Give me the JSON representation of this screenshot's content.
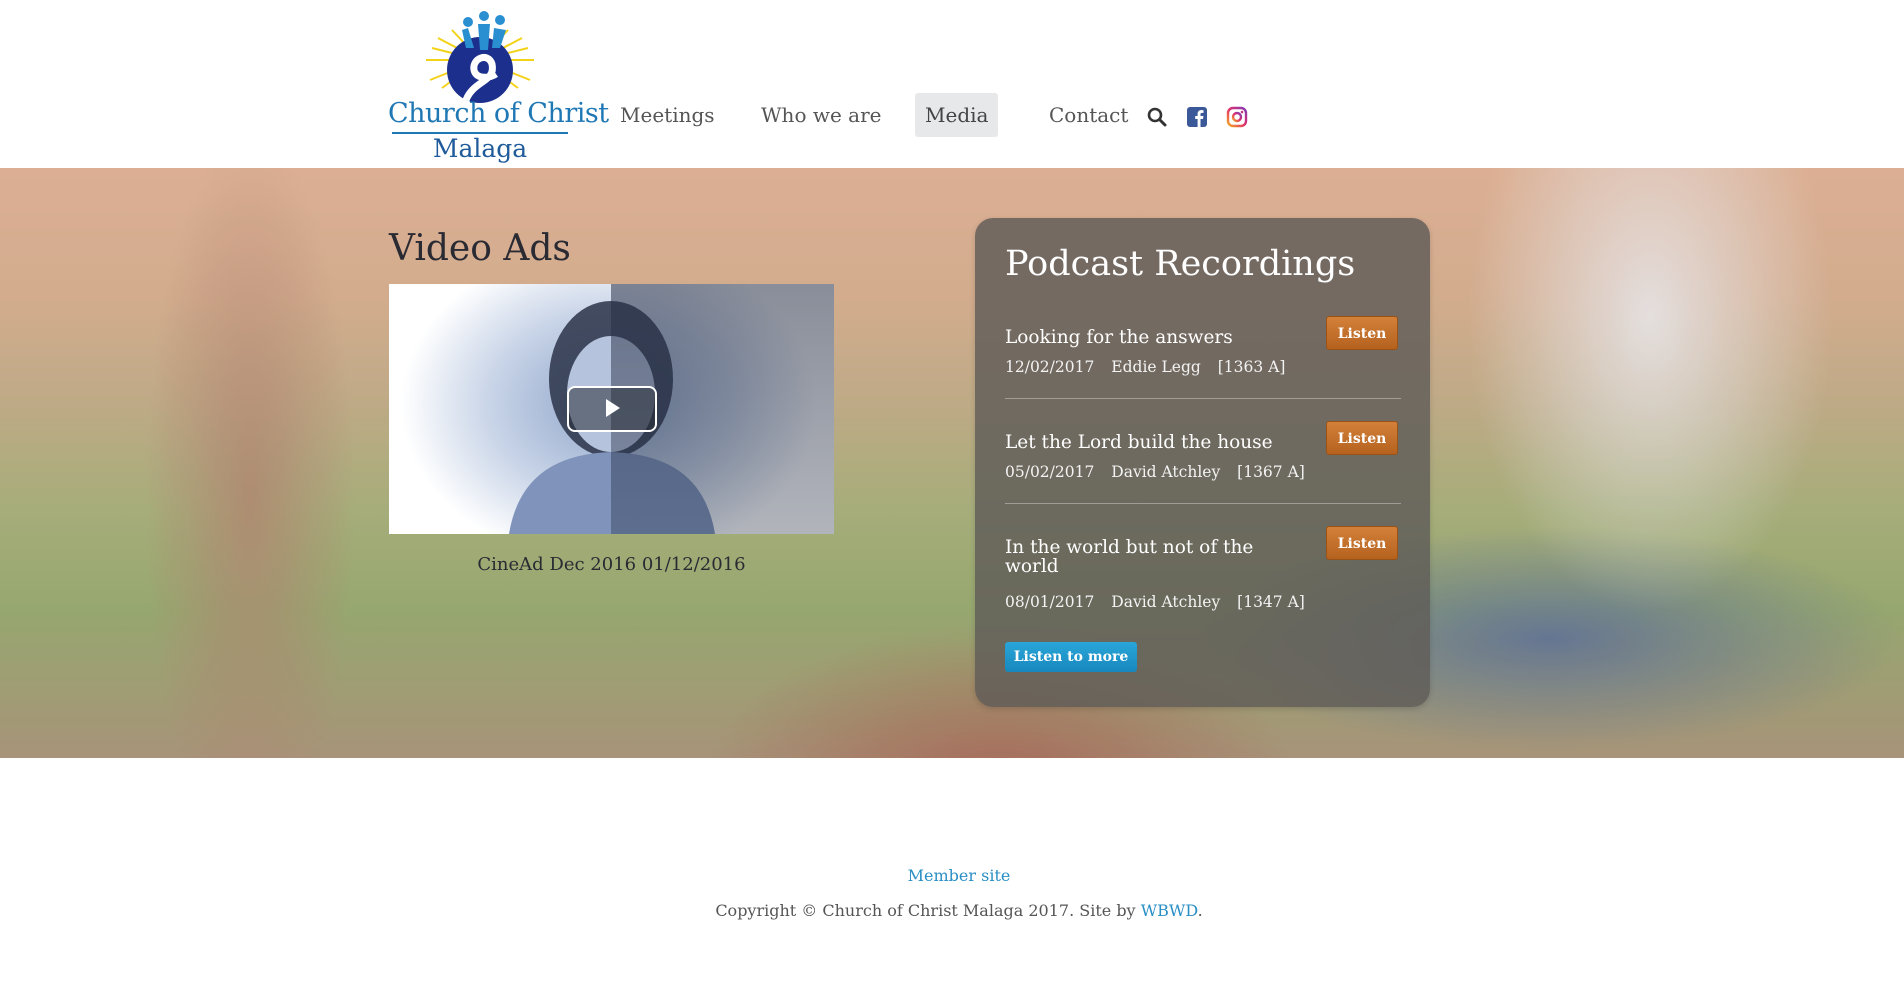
{
  "brand": {
    "logo_line1": "Church of Christ",
    "logo_line2": "Malaga",
    "colors": {
      "blue": "#1f78b4",
      "sun": "#f3d21a"
    }
  },
  "nav": {
    "items": [
      {
        "label": "Meetings",
        "active": false
      },
      {
        "label": "Who we are",
        "active": false
      },
      {
        "label": "Media",
        "active": true
      },
      {
        "label": "Contact",
        "active": false
      }
    ],
    "icons": [
      "search-icon",
      "facebook-icon",
      "instagram-icon"
    ]
  },
  "video_section": {
    "title": "Video Ads",
    "caption": "CineAd Dec 2016 01/12/2016"
  },
  "podcast": {
    "title": "Podcast Recordings",
    "listen_label": "Listen",
    "more_label": "Listen to more",
    "episodes": [
      {
        "title": "Looking for the answers",
        "date": "12/02/2017",
        "speaker": "Eddie Legg",
        "code": "[1363 A]"
      },
      {
        "title": "Let the Lord build the house",
        "date": "05/02/2017",
        "speaker": "David Atchley",
        "code": "[1367 A]"
      },
      {
        "title": "In the world but not of the world",
        "date": "08/01/2017",
        "speaker": "David Atchley",
        "code": "[1347 A]"
      }
    ],
    "colors": {
      "listen": "#c4702b",
      "more": "#1f98cd"
    }
  },
  "footer": {
    "member_link": "Member site",
    "copyright_text": "Copyright © Church of Christ Malaga 2017. Site by ",
    "credit_link": "WBWD",
    "copyright_end": "."
  }
}
